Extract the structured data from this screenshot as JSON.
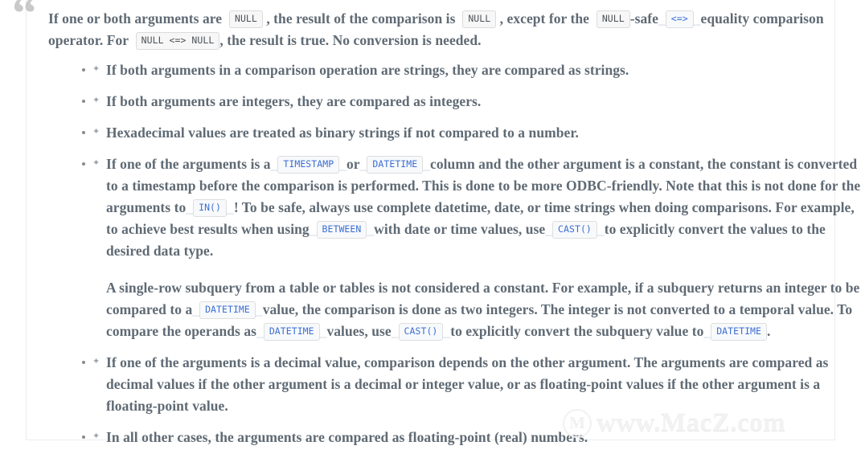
{
  "quote": {
    "mark": "“"
  },
  "intro": {
    "s1": "If one or both arguments are",
    "t1": "NULL",
    "s2": ", the result of the comparison is",
    "t2": "NULL",
    "s3": ", except for the",
    "t3": "NULL",
    "s4": "-safe",
    "t4": "<=>",
    "s5": "equality comparison operator. For",
    "t5": "NULL <=> NULL",
    "s6": ", the result is true. No conversion is needed."
  },
  "bullets": [
    {
      "marker_dot": "•",
      "marker_arrow": "✦",
      "paragraphs": [
        {
          "text": "If both arguments in a comparison operation are strings, they are compared as strings."
        }
      ]
    },
    {
      "marker_dot": "•",
      "marker_arrow": "✦",
      "paragraphs": [
        {
          "text": "If both arguments are integers, they are compared as integers."
        }
      ]
    },
    {
      "marker_dot": "•",
      "marker_arrow": "✦",
      "paragraphs": [
        {
          "text": "Hexadecimal values are treated as binary strings if not compared to a number."
        }
      ]
    },
    {
      "marker_dot": "•",
      "marker_arrow": "✦",
      "paragraphs": [
        {
          "s1": "If one of the arguments is a",
          "t1": "TIMESTAMP",
          "s2": "or",
          "t2": "DATETIME",
          "s3": "column and the other argument is a constant, the constant is converted to a timestamp before the comparison is performed. This is done to be more ODBC-friendly. Note that this is not done for the arguments to",
          "t3": "IN()",
          "s4": "! To be safe, always use complete datetime, date, or time strings when doing comparisons. For example, to achieve best results when using",
          "t4": "BETWEEN",
          "s5": "with date or time values, use",
          "t5": "CAST()",
          "s6": "to explicitly convert the values to the desired data type."
        },
        {
          "s1": "A single-row subquery from a table or tables is not considered a constant. For example, if a subquery returns an integer to be compared to a",
          "t1": "DATETIME",
          "s2": "value, the comparison is done as two integers. The integer is not converted to a temporal value. To compare the operands as",
          "t2": "DATETIME",
          "s3": "values, use",
          "t3": "CAST()",
          "s4": "to explicitly convert the subquery value to",
          "t4": "DATETIME",
          "s5": "."
        }
      ]
    },
    {
      "marker_dot": "•",
      "marker_arrow": "✦",
      "paragraphs": [
        {
          "text": "If one of the arguments is a decimal value, comparison depends on the other argument. The arguments are compared as decimal values if the other argument is a decimal or integer value, or as floating-point values if the other argument is a floating-point value."
        }
      ]
    },
    {
      "marker_dot": "•",
      "marker_arrow": "✦",
      "paragraphs": [
        {
          "text": "In all other cases, the arguments are compared as floating-point (real) numbers."
        }
      ]
    }
  ],
  "watermark": {
    "logo_letter": "M",
    "text": "www.MacZ.com"
  },
  "colors": {
    "body_text": "#5f6a74",
    "code_link": "#3b6fd4",
    "code_text": "#4d5258",
    "code_bg": "#f7f7f7",
    "code_border": "#dcdcdc",
    "quote_mark": "#c9c9c9",
    "panel_border": "#ececec",
    "watermark": "#f2f2f2"
  }
}
